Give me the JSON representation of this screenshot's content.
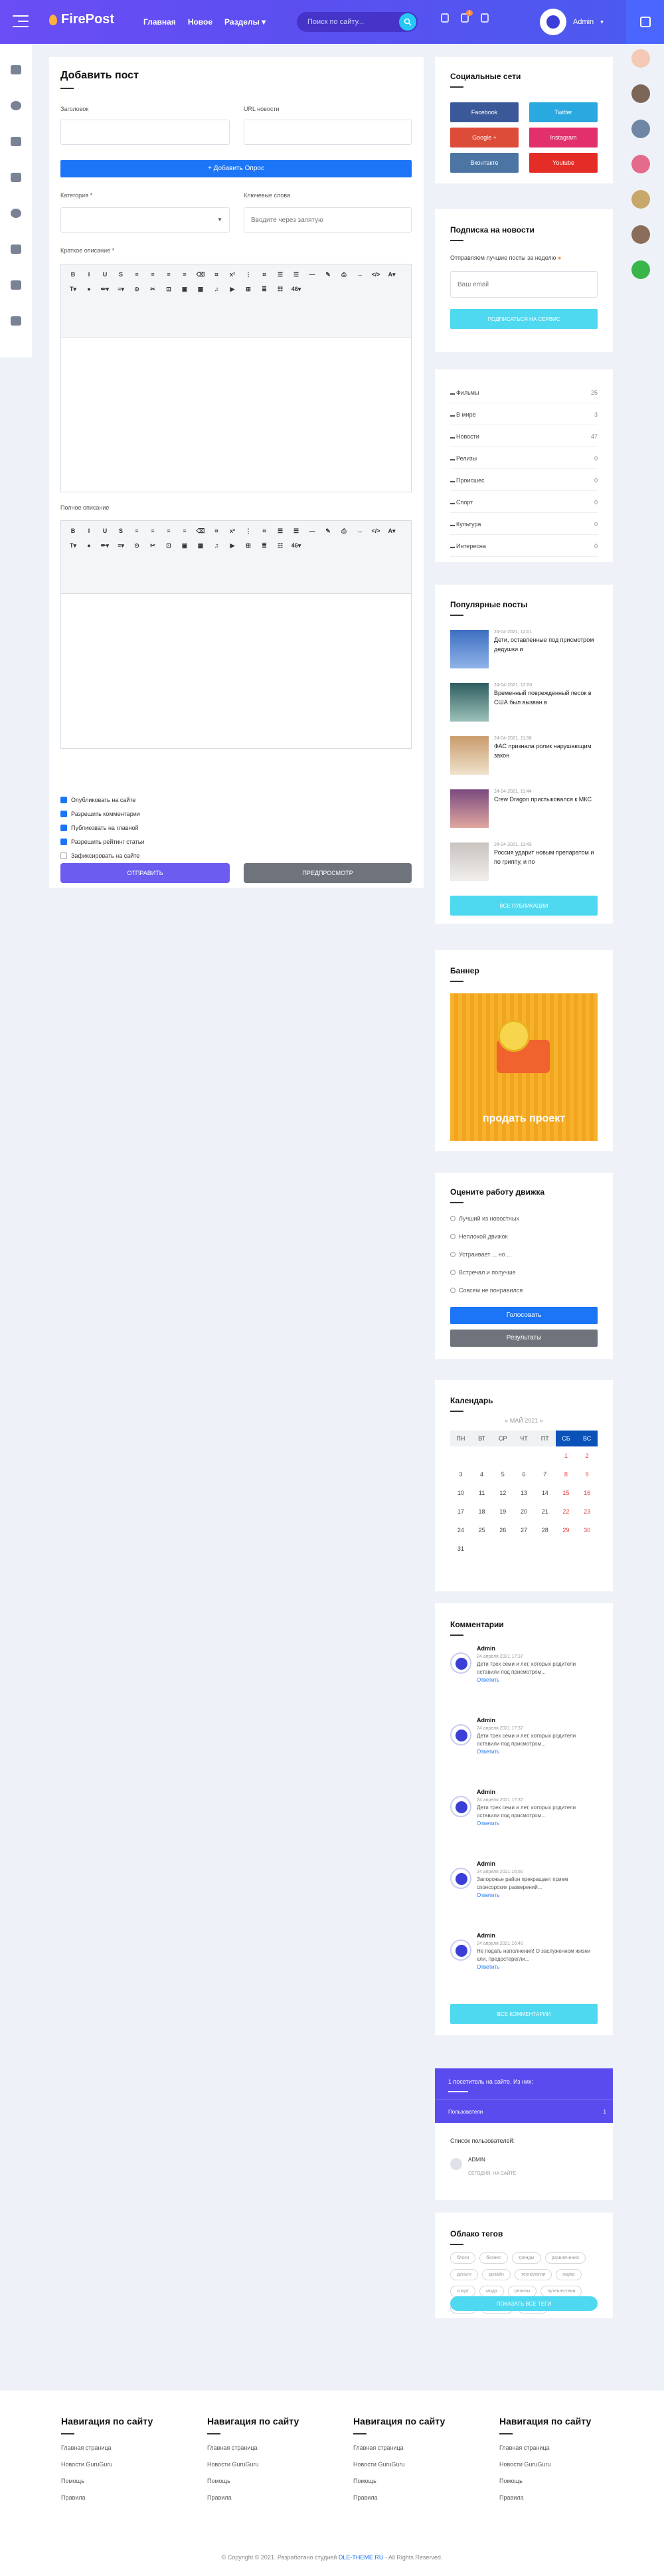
{
  "header": {
    "logo": "FirePost",
    "nav": [
      {
        "label": "Главная"
      },
      {
        "label": "Новое"
      },
      {
        "label": "Разделы"
      }
    ],
    "search_placeholder": "Поиск по сайту...",
    "badge": "1",
    "user": "Admin"
  },
  "left_rail": [
    "list-icon",
    "info-icon",
    "users-icon",
    "people-icon",
    "play-icon",
    "music-icon",
    "chat-icon",
    "cart-icon"
  ],
  "form": {
    "title": "Добавить пост",
    "title_label": "Заголовок",
    "url_label": "URL новости",
    "poll_button": "+ Добавить Опрос",
    "category_label": "Категория *",
    "keywords_label": "Ключевые слова",
    "keywords_placeholder": "Вводите через запятую",
    "short_label": "Краткое описание *",
    "full_label": "Полное описание",
    "toolbar": [
      "B",
      "I",
      "U",
      "S",
      "≡",
      "≡",
      "≡",
      "≡",
      "⌫",
      "⌗",
      "x²",
      "⋮",
      "⌗",
      "☰",
      "☰",
      "—",
      "✎",
      "⎙",
      "↔",
      "</>",
      "A▾",
      "T▾",
      "●",
      "✏▾",
      "≡▾",
      "⊙",
      "✂",
      "⊡",
      "▣",
      "▦",
      "♫",
      "▶",
      "⊞",
      "≣",
      "☷",
      "46▾"
    ],
    "options": [
      {
        "label": "Опубликовать на сайте",
        "on": true
      },
      {
        "label": "Разрешить комментарии",
        "on": true
      },
      {
        "label": "Публиковать на главной",
        "on": true
      },
      {
        "label": "Разрешить рейтинг статьи",
        "on": true
      },
      {
        "label": "Зафиксировать на сайте",
        "on": false
      }
    ],
    "submit": "ОТПРАВИТЬ",
    "preview": "ПРЕДПРОСМОТР"
  },
  "social": {
    "title": "Социальные сети",
    "buttons": [
      {
        "label": "Facebook",
        "color": "#3b5998"
      },
      {
        "label": "Twitter",
        "color": "#2aa9e0"
      },
      {
        "label": "Google +",
        "color": "#dd4b39"
      },
      {
        "label": "Instagram",
        "color": "#e1306c"
      },
      {
        "label": "Вконтакте",
        "color": "#4c75a3"
      },
      {
        "label": "Youtube",
        "color": "#e52d27"
      }
    ]
  },
  "subscribe": {
    "title": "Подписка на новости",
    "text": "Отправляем лучшие посты за неделю",
    "placeholder": "Ваш email",
    "button": "ПОДПИСАТЬСЯ НА СЕРВИС"
  },
  "categories": [
    {
      "name": "Фильмы",
      "count": "25"
    },
    {
      "name": "В мире",
      "count": "3"
    },
    {
      "name": "Новости",
      "count": "47"
    },
    {
      "name": "Релизы",
      "count": "0"
    },
    {
      "name": "Происшес",
      "count": "0"
    },
    {
      "name": "Спорт",
      "count": "0"
    },
    {
      "name": "Культура",
      "count": "0"
    },
    {
      "name": "Интересна",
      "count": "0"
    }
  ],
  "popular": {
    "title": "Популярные посты",
    "items": [
      {
        "date": "24-04-2021, 12:01",
        "text": "Дети, оставленные под присмотром дедушки и"
      },
      {
        "date": "24-04-2021, 12:00",
        "text": "Временный поврежденный песок в США был вызван в"
      },
      {
        "date": "24-04-2021, 11:58",
        "text": "ФАС признала ролик нарушающим закон"
      },
      {
        "date": "24-04-2021, 11:44",
        "text": "Crew Dragon пристыковался к МКС"
      },
      {
        "date": "24-04-2021, 11:43",
        "text": "Россия ударит новым препаратом и по гриппу, и по"
      }
    ],
    "button": "ВСЕ ПУБЛИКАЦИИ"
  },
  "banner": {
    "title": "Баннер",
    "caption": "продать проект"
  },
  "poll": {
    "title": "Оцените работу движка",
    "options": [
      "Лучший из новостных",
      "Неплохой движок",
      "Устраивает ... но ...",
      "Встречал и получше",
      "Совсем не понравился"
    ],
    "vote": "Голосовать",
    "results": "Результаты"
  },
  "calendar": {
    "title": "Календарь",
    "month": "« МАЙ 2021",
    "days": [
      "ПН",
      "ВТ",
      "СР",
      "ЧТ",
      "ПТ",
      "СБ",
      "ВС"
    ],
    "cells": [
      "",
      "",
      "",
      "",
      "",
      "1",
      "2",
      "3",
      "4",
      "5",
      "6",
      "7",
      "8",
      "9",
      "10",
      "11",
      "12",
      "13",
      "14",
      "15",
      "16",
      "17",
      "18",
      "19",
      "20",
      "21",
      "22",
      "23",
      "24",
      "25",
      "26",
      "27",
      "28",
      "29",
      "30",
      "31",
      "",
      "",
      "",
      "",
      "",
      ""
    ]
  },
  "comments": {
    "title": "Комментарии",
    "items": [
      {
        "name": "Admin",
        "date": "24 апреля 2021 17:37",
        "text": "Дети трех семи и лет, которых родители оставили под присмотром...",
        "reply": "Ответить"
      },
      {
        "name": "Admin",
        "date": "24 апреля 2021 17:37",
        "text": "Дети трех семи и лет, которых родители оставили под присмотром...",
        "reply": "Ответить"
      },
      {
        "name": "Admin",
        "date": "24 апреля 2021 17:37",
        "text": "Дети трех семи и лет, которых родители оставили под присмотром...",
        "reply": "Ответить"
      },
      {
        "name": "Admin",
        "date": "24 апреля 2021 16:50",
        "text": "Запорожье район прекращает прием спонсорских разверений...",
        "reply": "Ответить"
      },
      {
        "name": "Admin",
        "date": "24 апреля 2021 16:40",
        "text": "Не подать наполнения! О заслуженном жизни ели, предостерегли...",
        "reply": "Ответить"
      }
    ],
    "button": "ВСЕ КОММЕНТАРИИ"
  },
  "online": {
    "head": "1 посетитель на сайте. Из них:",
    "users_label": "Пользователи",
    "users_count": "1",
    "list_title": "Список пользователей:",
    "user": "ADMIN",
    "status": "СЕГОДНЯ, НА САЙТЕ"
  },
  "tags": {
    "title": "Облако тегов",
    "items": [
      "блоги",
      "бизнес",
      "тренды",
      "развлечения",
      "деньги",
      "дизайн",
      "технологии",
      "наука",
      "спорт",
      "мода",
      "релизы",
      "путешествия",
      "видео",
      "интернет",
      "новости"
    ],
    "button": "ПОКАЗАТЬ ВСЕ ТЕГИ"
  },
  "footer": {
    "columns": [
      {
        "title": "Навигация по сайту",
        "links": [
          "Главная страница",
          "Новости GuruGuru",
          "Помощь",
          "Правила"
        ]
      },
      {
        "title": "Навигация по сайту",
        "links": [
          "Главная страница",
          "Новости GuruGuru",
          "Помощь",
          "Правила"
        ]
      },
      {
        "title": "Навигация по сайту",
        "links": [
          "Главная страница",
          "Новости GuruGuru",
          "Помощь",
          "Правила"
        ]
      },
      {
        "title": "Навигация по сайту",
        "links": [
          "Главная страница",
          "Новости GuruGuru",
          "Помощь",
          "Правила"
        ]
      }
    ],
    "copyright": "© Copyright © 2021. Разработано студией",
    "studio": "DLE-THEME.RU",
    "rights": "- All Rights Reserved."
  },
  "colors": {
    "accent": "#5b4ff0",
    "blue": "#1b75f6",
    "cyan": "#4ed9f0"
  }
}
